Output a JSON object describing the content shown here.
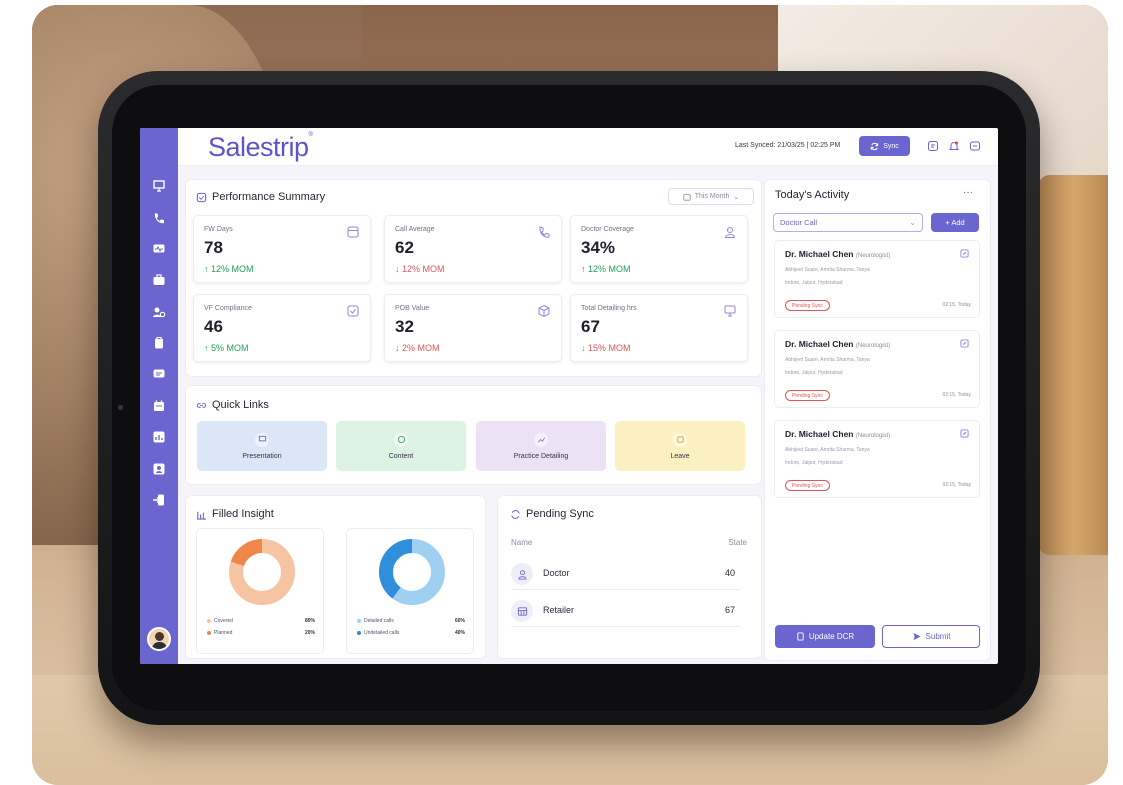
{
  "brand": {
    "logo_text": "Salestrip",
    "logo_mark": "®",
    "accent": "#6b66cf"
  },
  "topbar": {
    "last_synced": "Last Synced: 21/03/25 | 02:25 PM",
    "sync_label": "Sync"
  },
  "sidebar": {
    "icons": [
      "presentation-icon",
      "phone-icon",
      "monitor-icon",
      "briefcase-icon",
      "settings-users-icon",
      "clipboard-icon",
      "chat-icon",
      "calendar-icon",
      "chart-icon",
      "contact-icon",
      "logout-icon"
    ]
  },
  "performance": {
    "title": "Performance Summary",
    "period": "This Month",
    "metrics": [
      {
        "label": "FW Days",
        "value": "78",
        "trend": "↑ 12% MOM",
        "direction": "up"
      },
      {
        "label": "Call Average",
        "value": "62",
        "trend": "↓ 12% MOM",
        "direction": "down"
      },
      {
        "label": "Doctor Coverage",
        "value": "34%",
        "trend": "↑ 12% MOM",
        "direction": "up"
      },
      {
        "label": "VF Compliance",
        "value": "46",
        "trend": "↑ 5% MOM",
        "direction": "up"
      },
      {
        "label": "POB Value",
        "value": "32",
        "trend": "↓ 2% MOM",
        "direction": "down"
      },
      {
        "label": "Total Detailing hrs",
        "value": "67",
        "trend": "↓ 15% MOM",
        "direction": "down"
      }
    ]
  },
  "quick_links": {
    "title": "Quick Links",
    "items": [
      {
        "label": "Presentation",
        "color": "#dbe6f7"
      },
      {
        "label": "Content",
        "color": "#dcf2e3"
      },
      {
        "label": "Practice Detailing",
        "color": "#ece1f5"
      },
      {
        "label": "Leave",
        "color": "#fbf0bf"
      }
    ]
  },
  "filled_insight": {
    "title": "Filled Insight",
    "charts": [
      {
        "legend": [
          {
            "label": "Covered",
            "value": "80%",
            "color": "#f7c4a3"
          },
          {
            "label": "Planned",
            "value": "20%",
            "color": "#f0864a"
          }
        ]
      },
      {
        "legend": [
          {
            "label": "Detailed calls",
            "value": "60%",
            "color": "#9fd0f2"
          },
          {
            "label": "Undetailed calls",
            "value": "40%",
            "color": "#2f8fdc"
          }
        ]
      }
    ]
  },
  "chart_data": [
    {
      "type": "pie",
      "categories": [
        "Covered",
        "Planned"
      ],
      "values": [
        80,
        20
      ]
    },
    {
      "type": "pie",
      "categories": [
        "Detailed calls",
        "Undetailed calls"
      ],
      "values": [
        60,
        40
      ]
    }
  ],
  "pending_sync": {
    "title": "Pending Sync",
    "col_name": "Name",
    "col_state": "State",
    "rows": [
      {
        "name": "Doctor",
        "state": "40"
      },
      {
        "name": "Retailer",
        "state": "67"
      }
    ]
  },
  "activity": {
    "title": "Today's Activity",
    "more": "···",
    "dropdown_value": "Doctor Call",
    "add_label": "+ Add",
    "items": [
      {
        "name": "Dr. Michael Chen",
        "specialty": "(Neurologist)",
        "line1": "Abhijeet Suare, Amrita Sharma, Tanya",
        "line2": "Indore, Jaipur, Hyderabad",
        "status": "Pending Sync",
        "time": "02:15, Today"
      },
      {
        "name": "Dr. Michael Chen",
        "specialty": "(Neurologist)",
        "line1": "Abhijeet Suare, Amrita Sharma, Tanya",
        "line2": "Indore, Jaipur, Hyderabad",
        "status": "Pending Sync",
        "time": "02:15, Today"
      },
      {
        "name": "Dr. Michael Chen",
        "specialty": "(Neurologist)",
        "line1": "Abhijeet Suare, Amrita Sharma, Tanya",
        "line2": "Indore, Jaipur, Hyderabad",
        "status": "Pending Sync",
        "time": "02:15, Today"
      }
    ],
    "update_label": "Update DCR",
    "submit_label": "Submit"
  }
}
